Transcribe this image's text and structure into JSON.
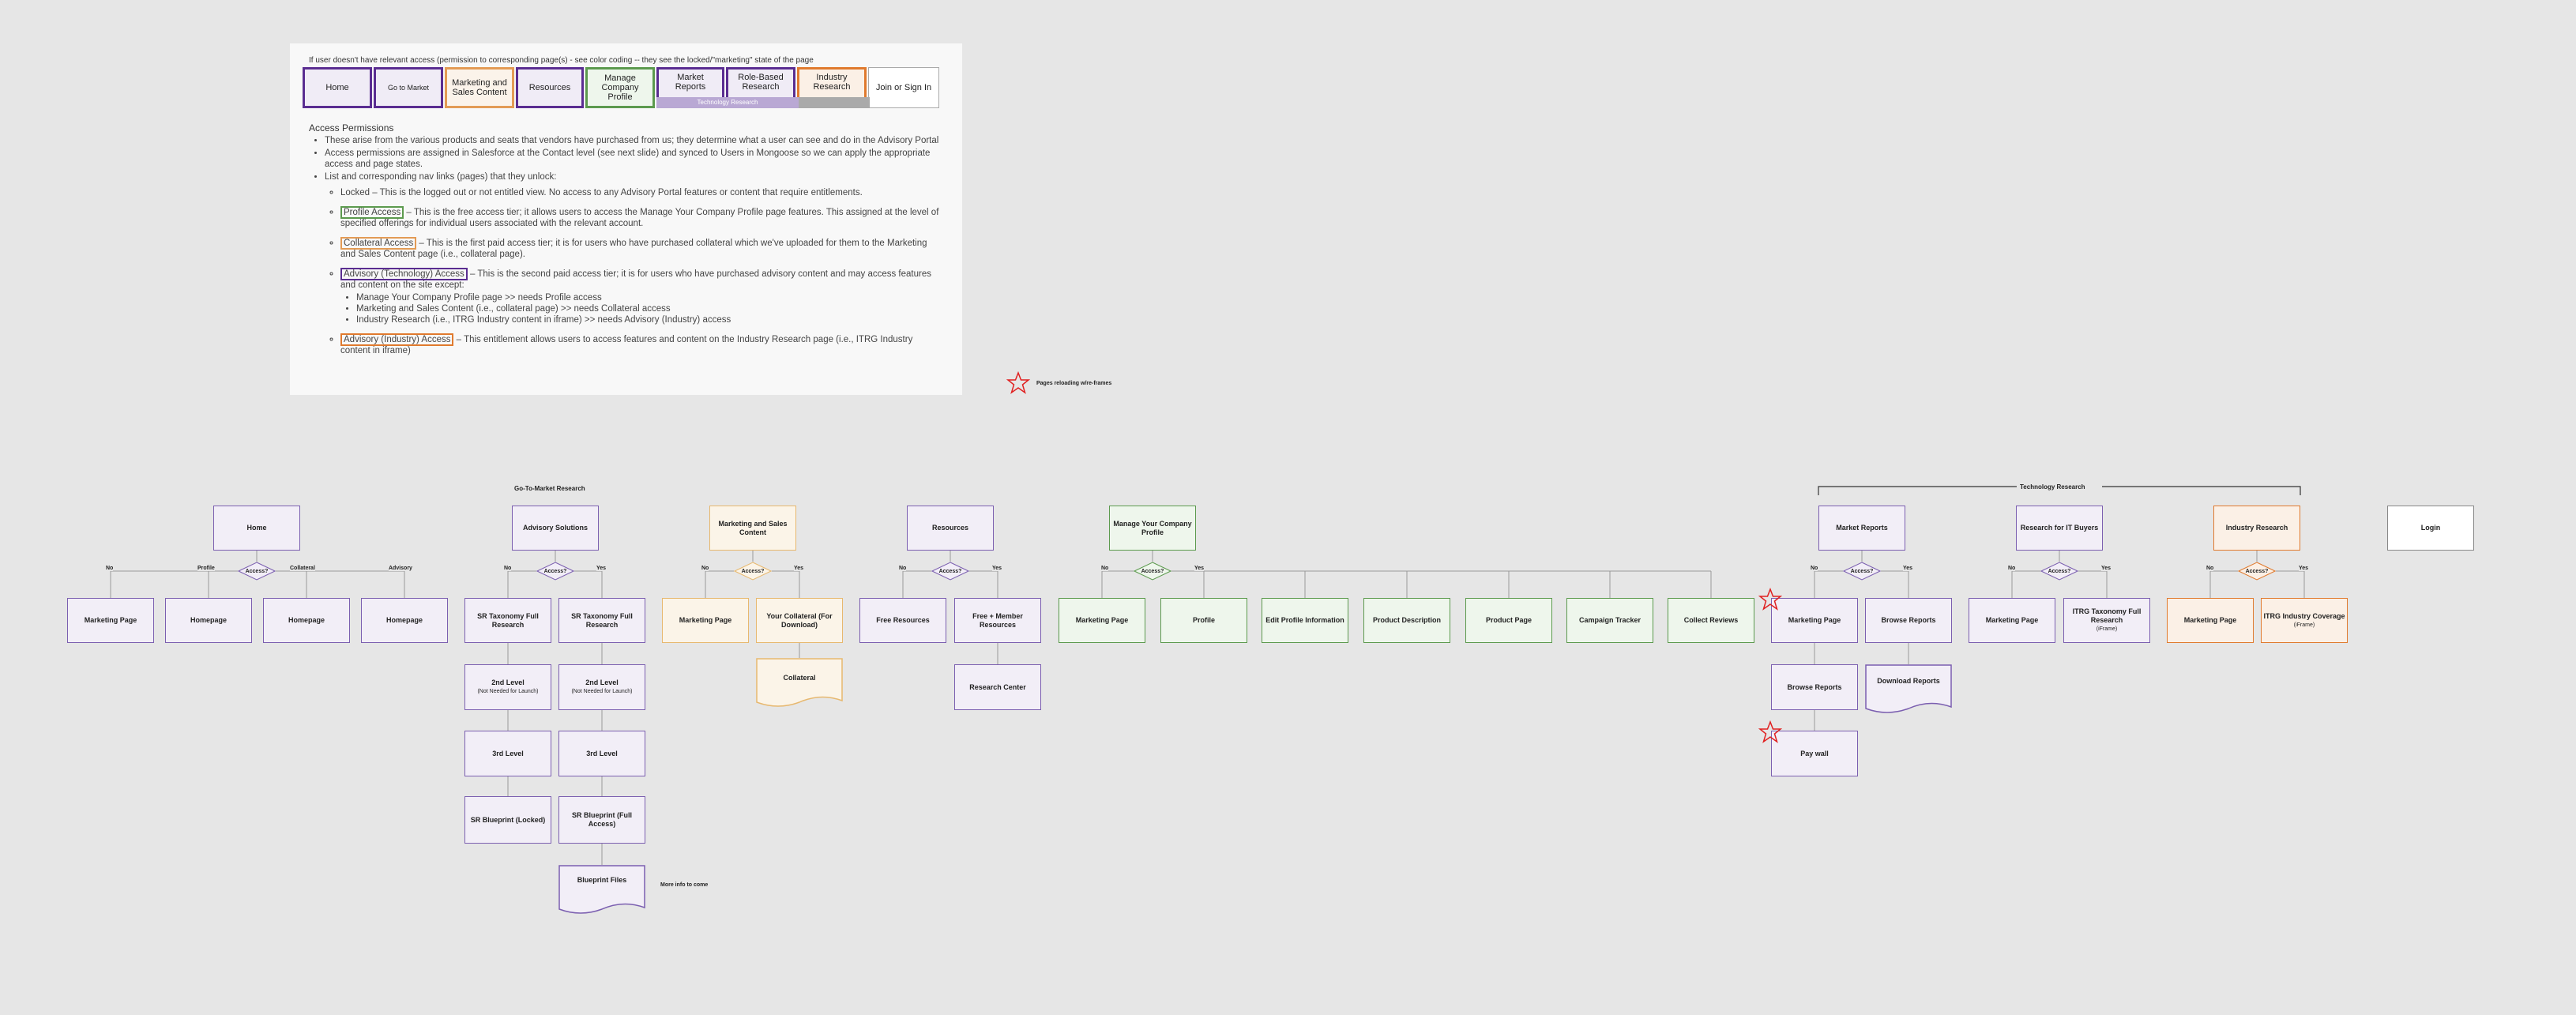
{
  "panel": {
    "note": "If user doesn't have relevant access (permission to corresponding page(s) - see color coding -- they see the locked/\"marketing\" state of the page",
    "tabs": [
      "Home",
      "Go to Market",
      "Marketing and Sales Content",
      "Resources",
      "Manage Company Profile",
      "Market Reports",
      "Role-Based Research",
      "Industry Research",
      "Join or Sign In"
    ],
    "tech_bar": "Technology Research",
    "access_title": "Access Permissions",
    "bullet1": "These arise from the various products and seats that vendors have purchased from us; they determine what a user can see and do in the Advisory Portal",
    "bullet2": "Access permissions are assigned in Salesforce at the Contact level (see next slide) and synced to Users in Mongoose so we can apply the appropriate access and page states.",
    "bullet3": "List and corresponding nav links (pages) that they unlock:",
    "locked": "Locked – This is the logged out or not entitled view.  No access to any Advisory Portal features or content that require entitlements.",
    "profile_tag": "Profile Access",
    "profile_text": " – This is the free access tier; it allows users to access the Manage Your Company Profile page features.  This assigned at the level of specified offerings for individual users associated with the relevant account.",
    "collateral_tag": "Collateral Access",
    "collateral_text": " – This is the first paid access tier; it is for users who have purchased collateral which we've uploaded for them to the Marketing and Sales Content page (i.e., collateral page).",
    "advtech_tag": "Advisory (Technology) Access",
    "advtech_text": " – This is the second paid access tier; it is for users who have purchased advisory content and may access features and content on the site except:",
    "advtech_sub": [
      "Manage Your Company Profile page >> needs Profile access",
      "Marketing and Sales Content (i.e., collateral page) >> needs Collateral access",
      "Industry Research (i.e., ITRG Industry content in iframe) >> needs Advisory (Industry) access"
    ],
    "advind_tag": "Advisory (Industry) Access",
    "advind_text": " – This entitlement allows users to access features and content on the Industry Research page (i.e., ITRG Industry content in iframe)"
  },
  "legend": "Pages reloading w/re-frames",
  "sections": {
    "gtm": "Go-To-Market Research",
    "tech": "Technology Research"
  },
  "nodes": {
    "home": "Home",
    "advisory_solutions": "Advisory Solutions",
    "msc": "Marketing and Sales Content",
    "resources": "Resources",
    "manage_profile": "Manage Your Company Profile",
    "market_reports": "Market Reports",
    "research_it": "Research for IT Buyers",
    "industry_research": "Industry Research",
    "login": "Login",
    "h_marketing": "Marketing Page",
    "h_home1": "Homepage",
    "h_home2": "Homepage",
    "h_home3": "Homepage",
    "sr_tax1": "SR Taxonomy Full Research",
    "sr_tax2": "SR Taxonomy Full Research",
    "lvl2a": "2nd Level",
    "lvl2a_s": "(Not Needed for Launch)",
    "lvl2b": "2nd Level",
    "lvl2b_s": "(Not Needed for Launch)",
    "lvl3a": "3rd Level",
    "lvl3b": "3rd Level",
    "bp_locked": "SR Blueprint (Locked)",
    "bp_full": "SR Blueprint (Full Access)",
    "bp_files": "Blueprint Files",
    "bp_note": "More info to come",
    "msc_marketing": "Marketing Page",
    "msc_collat": "Your Collateral (For Download)",
    "collateral": "Collateral",
    "free_res": "Free Resources",
    "free_member": "Free + Member Resources",
    "research_center": "Research Center",
    "mp_marketing": "Marketing Page",
    "mp_profile": "Profile",
    "mp_edit": "Edit Profile Information",
    "mp_pd": "Product Description",
    "mp_pp": "Product Page",
    "mp_ct": "Campaign Tracker",
    "mp_cr": "Collect Reviews",
    "mr_marketing": "Marketing Page",
    "mr_browse": "Browse Reports",
    "mr_browse2": "Browse Reports",
    "mr_download": "Download Reports",
    "mr_paywall": "Pay wall",
    "rit_marketing": "Marketing Page",
    "rit_itrg": "ITRG Taxonomy Full Research",
    "rit_itrg_s": "(iFrame)",
    "ir_marketing": "Marketing Page",
    "ir_itrg": "ITRG Industry Coverage",
    "ir_itrg_s": "(iFrame)"
  },
  "decisions": {
    "access": "Access?"
  },
  "edge_labels": {
    "no": "No",
    "yes": "Yes",
    "profile": "Profile",
    "collateral": "Collateral",
    "advisory": "Advisory"
  },
  "colors": {
    "purple": "#7b5fb0",
    "orange": "#e7b86f",
    "dark_orange": "#e07a2e",
    "green": "#5c9a4e",
    "star": "#e02020"
  }
}
